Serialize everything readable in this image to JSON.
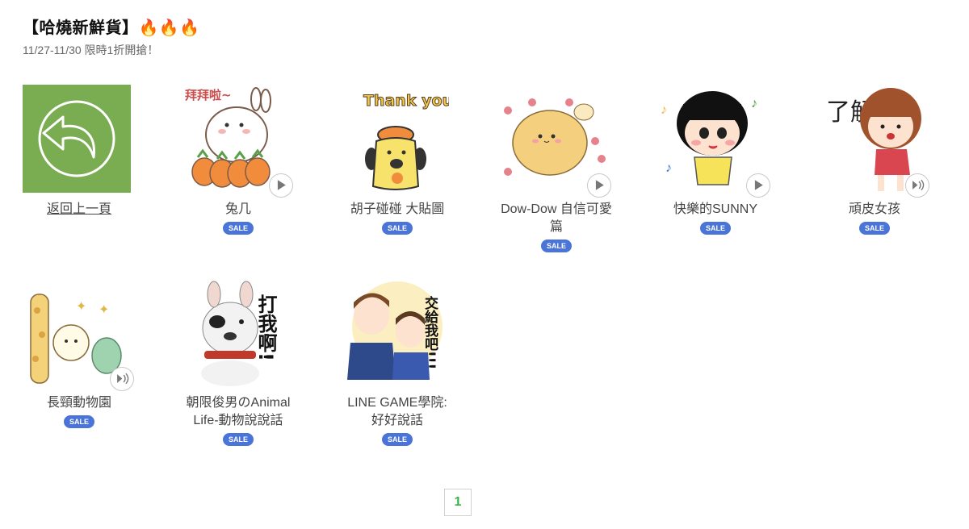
{
  "header": {
    "title": "【哈燒新鮮貨】🔥🔥🔥",
    "subtitle": "11/27-11/30 限時1折開搶！"
  },
  "back": {
    "label": "返回上一頁",
    "icon": "back-arrow-icon",
    "bg": "#7aad52"
  },
  "badge_label": "SALE",
  "items": [
    {
      "name": "兔几",
      "icon": "rabbit-sticker",
      "thumb_text": "拜拜啦~"
    },
    {
      "name": "胡子碰碰 大貼圖",
      "icon": "dog-sticker",
      "thumb_text": "Thank you!"
    },
    {
      "name": "Dow-Dow 自信可愛篇",
      "icon": "blob-sticker"
    },
    {
      "name": "快樂的SUNNY",
      "icon": "girl-sticker"
    },
    {
      "name": "頑皮女孩",
      "icon": "girl-sticker",
      "thumb_text": "了解"
    },
    {
      "name": "長頸動物園",
      "icon": "giraffe-sticker"
    },
    {
      "name": "朝限俊男のAnimal Life-動物說說話",
      "icon": "dog-sticker",
      "thumb_text": "打我啊!"
    },
    {
      "name": "LINE GAME學院: 好好說話",
      "icon": "boys-sticker",
      "thumb_text": "交給我吧!!!"
    }
  ],
  "pagination": {
    "current": "1"
  },
  "colors": {
    "sale": "#4a74d8",
    "accent": "#38b449"
  }
}
